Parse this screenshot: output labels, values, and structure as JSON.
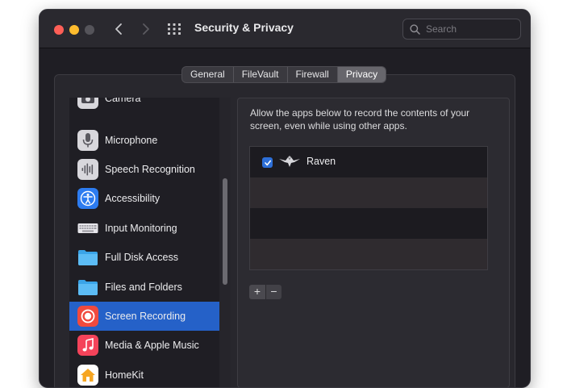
{
  "window": {
    "title": "Security & Privacy"
  },
  "search": {
    "placeholder": "Search"
  },
  "tabs": [
    {
      "label": "General",
      "active": false
    },
    {
      "label": "FileVault",
      "active": false
    },
    {
      "label": "Firewall",
      "active": false
    },
    {
      "label": "Privacy",
      "active": true
    }
  ],
  "sidebar": {
    "items": [
      {
        "label": "Camera",
        "icon": "camera-icon",
        "selected": false
      },
      {
        "label": "Microphone",
        "icon": "microphone-icon",
        "selected": false
      },
      {
        "label": "Speech Recognition",
        "icon": "speech-waveform-icon",
        "selected": false
      },
      {
        "label": "Accessibility",
        "icon": "accessibility-icon",
        "selected": false
      },
      {
        "label": "Input Monitoring",
        "icon": "keyboard-icon",
        "selected": false
      },
      {
        "label": "Full Disk Access",
        "icon": "folder-icon",
        "selected": false
      },
      {
        "label": "Files and Folders",
        "icon": "folder-icon",
        "selected": false
      },
      {
        "label": "Screen Recording",
        "icon": "screen-recording-icon",
        "selected": true
      },
      {
        "label": "Media & Apple Music",
        "icon": "music-note-icon",
        "selected": false
      },
      {
        "label": "HomeKit",
        "icon": "home-icon",
        "selected": false
      }
    ]
  },
  "panel": {
    "description": "Allow the apps below to record the contents of your screen, even while using other apps.",
    "apps": [
      {
        "name": "Raven",
        "checked": true,
        "icon": "raven-icon"
      }
    ],
    "add_label": "+",
    "remove_label": "−"
  },
  "colors": {
    "accent": "#2561c8",
    "close": "#fe5f57",
    "minimize": "#febc2e",
    "window_bg": "#1f1e24"
  }
}
